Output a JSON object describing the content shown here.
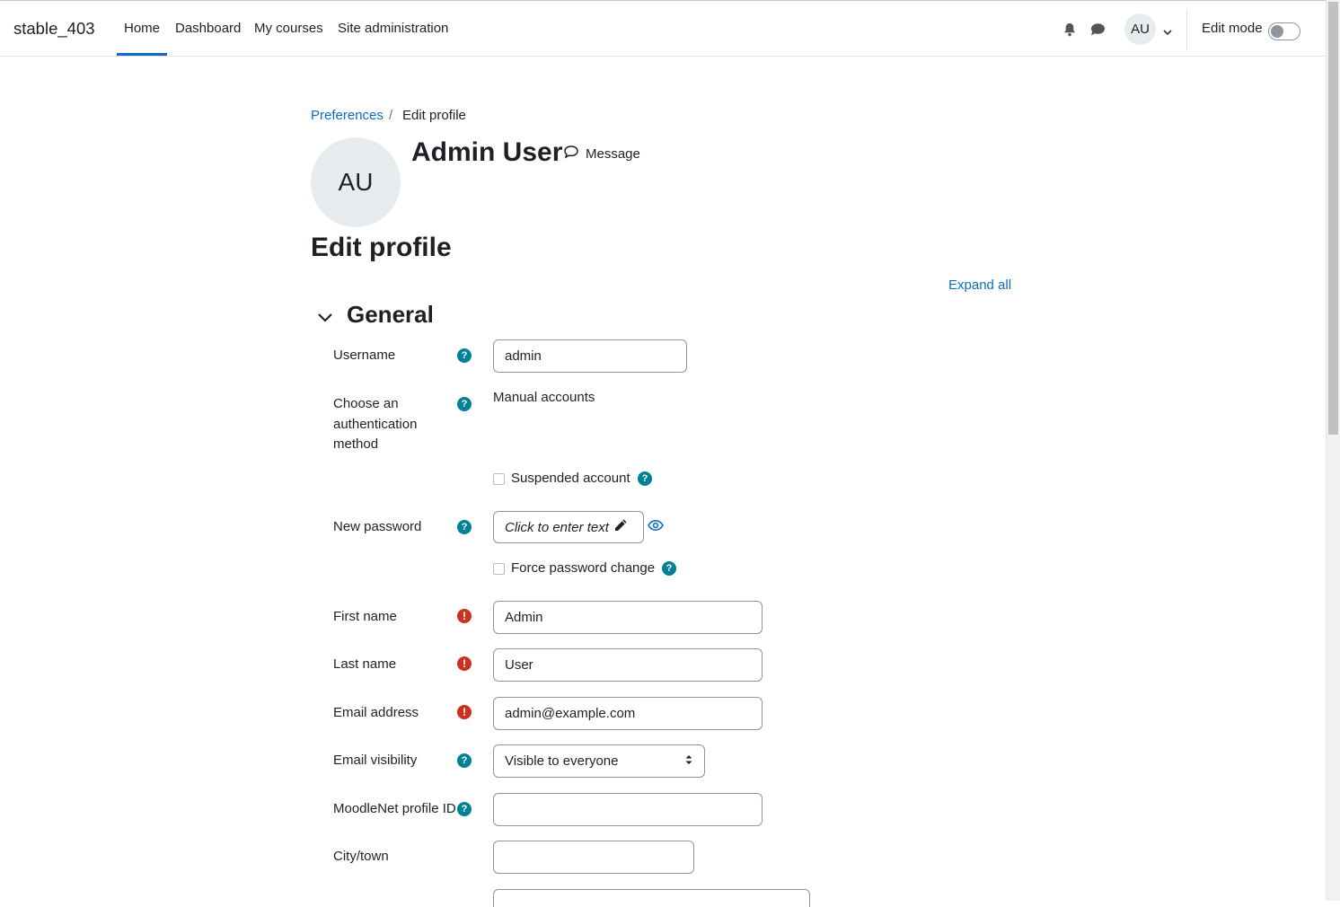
{
  "navbar": {
    "brand": "stable_403",
    "items": [
      "Home",
      "Dashboard",
      "My courses",
      "Site administration"
    ],
    "active_item": "Home",
    "user_initials": "AU",
    "edit_mode_label": "Edit mode",
    "edit_mode_on": false,
    "icons": [
      "bell-icon",
      "chat-bubble-icon",
      "chevron-down-icon"
    ]
  },
  "breadcrumb": {
    "link": "Preferences",
    "separator": "/",
    "current": "Edit profile"
  },
  "profile": {
    "initials": "AU",
    "name": "Admin User",
    "message_label": "Message"
  },
  "page_title": "Edit profile",
  "expand_all": "Expand all",
  "section": {
    "title": "General"
  },
  "form": {
    "username": {
      "label": "Username",
      "value": "admin"
    },
    "auth": {
      "label": "Choose an authentication method",
      "value": "Manual accounts"
    },
    "suspended": {
      "label": "Suspended account",
      "checked": false
    },
    "new_password": {
      "label": "New password",
      "placeholder": "Click to enter text"
    },
    "force_password_change": {
      "label": "Force password change",
      "checked": false
    },
    "first_name": {
      "label": "First name",
      "value": "Admin"
    },
    "last_name": {
      "label": "Last name",
      "value": "User"
    },
    "email": {
      "label": "Email address",
      "value": "admin@example.com"
    },
    "email_visibility": {
      "label": "Email visibility",
      "value": "Visible to everyone"
    },
    "moodlenet": {
      "label": "MoodleNet profile ID",
      "value": ""
    },
    "city": {
      "label": "City/town",
      "value": ""
    }
  },
  "colors": {
    "link": "#0f6cbf",
    "help": "#008196",
    "required": "#ca3120",
    "text": "#1d2125"
  }
}
